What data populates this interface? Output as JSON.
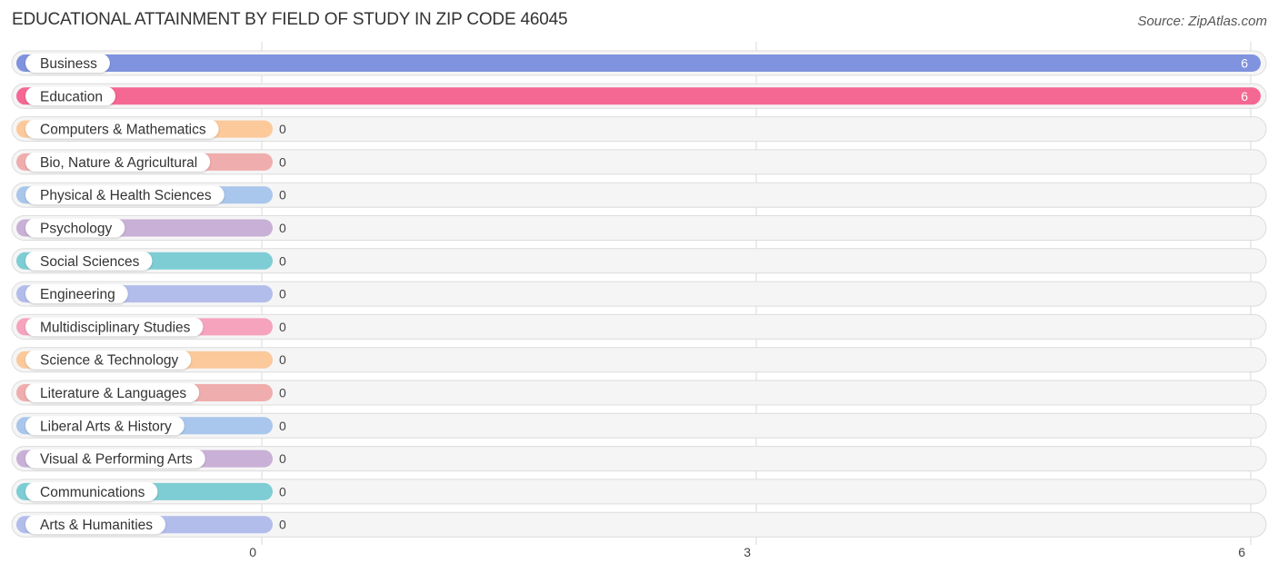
{
  "header": {
    "title": "EDUCATIONAL ATTAINMENT BY FIELD OF STUDY IN ZIP CODE 46045",
    "source": "Source: ZipAtlas.com"
  },
  "chart_data": {
    "type": "bar",
    "orientation": "horizontal",
    "title": "EDUCATIONAL ATTAINMENT BY FIELD OF STUDY IN ZIP CODE 46045",
    "xlabel": "",
    "ylabel": "",
    "xlim": [
      0,
      6
    ],
    "xticks": [
      0,
      3,
      6
    ],
    "grid": true,
    "categories": [
      "Business",
      "Education",
      "Computers & Mathematics",
      "Bio, Nature & Agricultural",
      "Physical & Health Sciences",
      "Psychology",
      "Social Sciences",
      "Engineering",
      "Multidisciplinary Studies",
      "Science & Technology",
      "Literature & Languages",
      "Liberal Arts & History",
      "Visual & Performing Arts",
      "Communications",
      "Arts & Humanities"
    ],
    "values": [
      6,
      6,
      0,
      0,
      0,
      0,
      0,
      0,
      0,
      0,
      0,
      0,
      0,
      0,
      0
    ],
    "colors": [
      "#7f93de",
      "#f46893",
      "#fbc99a",
      "#f0adad",
      "#a9c6ec",
      "#c9b0d6",
      "#7ecdd4",
      "#b3bdeb",
      "#f6a3be",
      "#fbc99a",
      "#f0adad",
      "#a9c6ec",
      "#c9b0d6",
      "#7ecdd4",
      "#b3bdeb"
    ]
  }
}
